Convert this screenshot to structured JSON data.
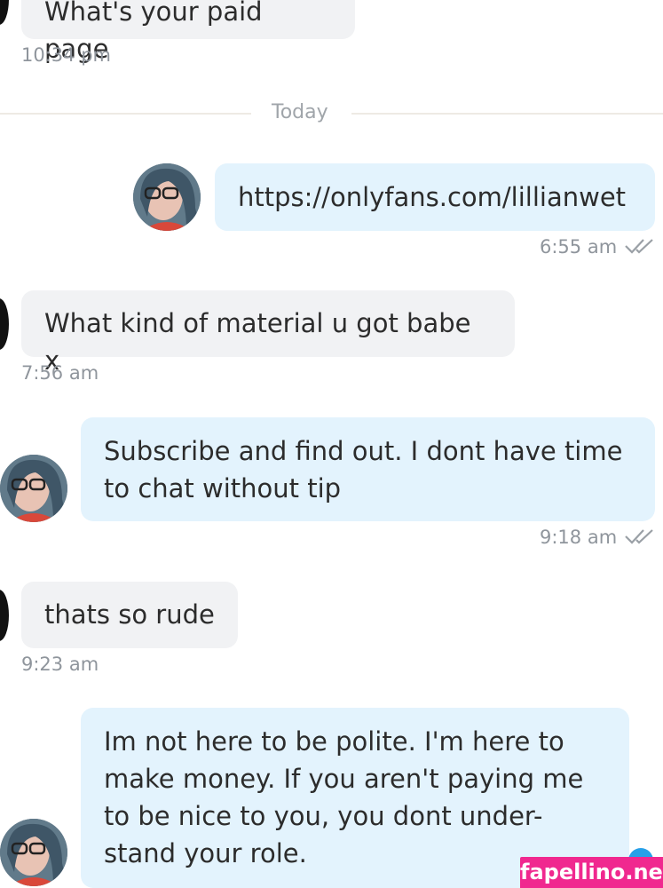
{
  "chat": {
    "messages": [
      {
        "direction": "in",
        "text": "What's your paid page",
        "time": "10:34 pm"
      },
      {
        "divider": "Today"
      },
      {
        "direction": "out",
        "text": "https://onlyfans.com/lillianwet",
        "time": "6:55 am",
        "read": true
      },
      {
        "direction": "in",
        "text": "What kind of material u got babe x",
        "time": "7:56 am"
      },
      {
        "direction": "out",
        "lines": [
          "Subscribe and find out. I dont have time",
          "to chat without tip"
        ],
        "time": "9:18 am",
        "read": true
      },
      {
        "direction": "in",
        "text": "thats so rude",
        "time": "9:23 am"
      },
      {
        "direction": "out",
        "lines": [
          "Im not here to be polite. I'm here to",
          "make money. If you aren't paying me",
          "to be nice to you, you dont under-",
          "stand your role."
        ]
      }
    ]
  },
  "watermark": "fapellino.net",
  "colors": {
    "incoming_bubble": "#f1f2f4",
    "outgoing_bubble": "#e3f3fd",
    "timestamp": "#8f959c",
    "accent": "#27a0e8",
    "watermark_bg": "#f0288f"
  }
}
